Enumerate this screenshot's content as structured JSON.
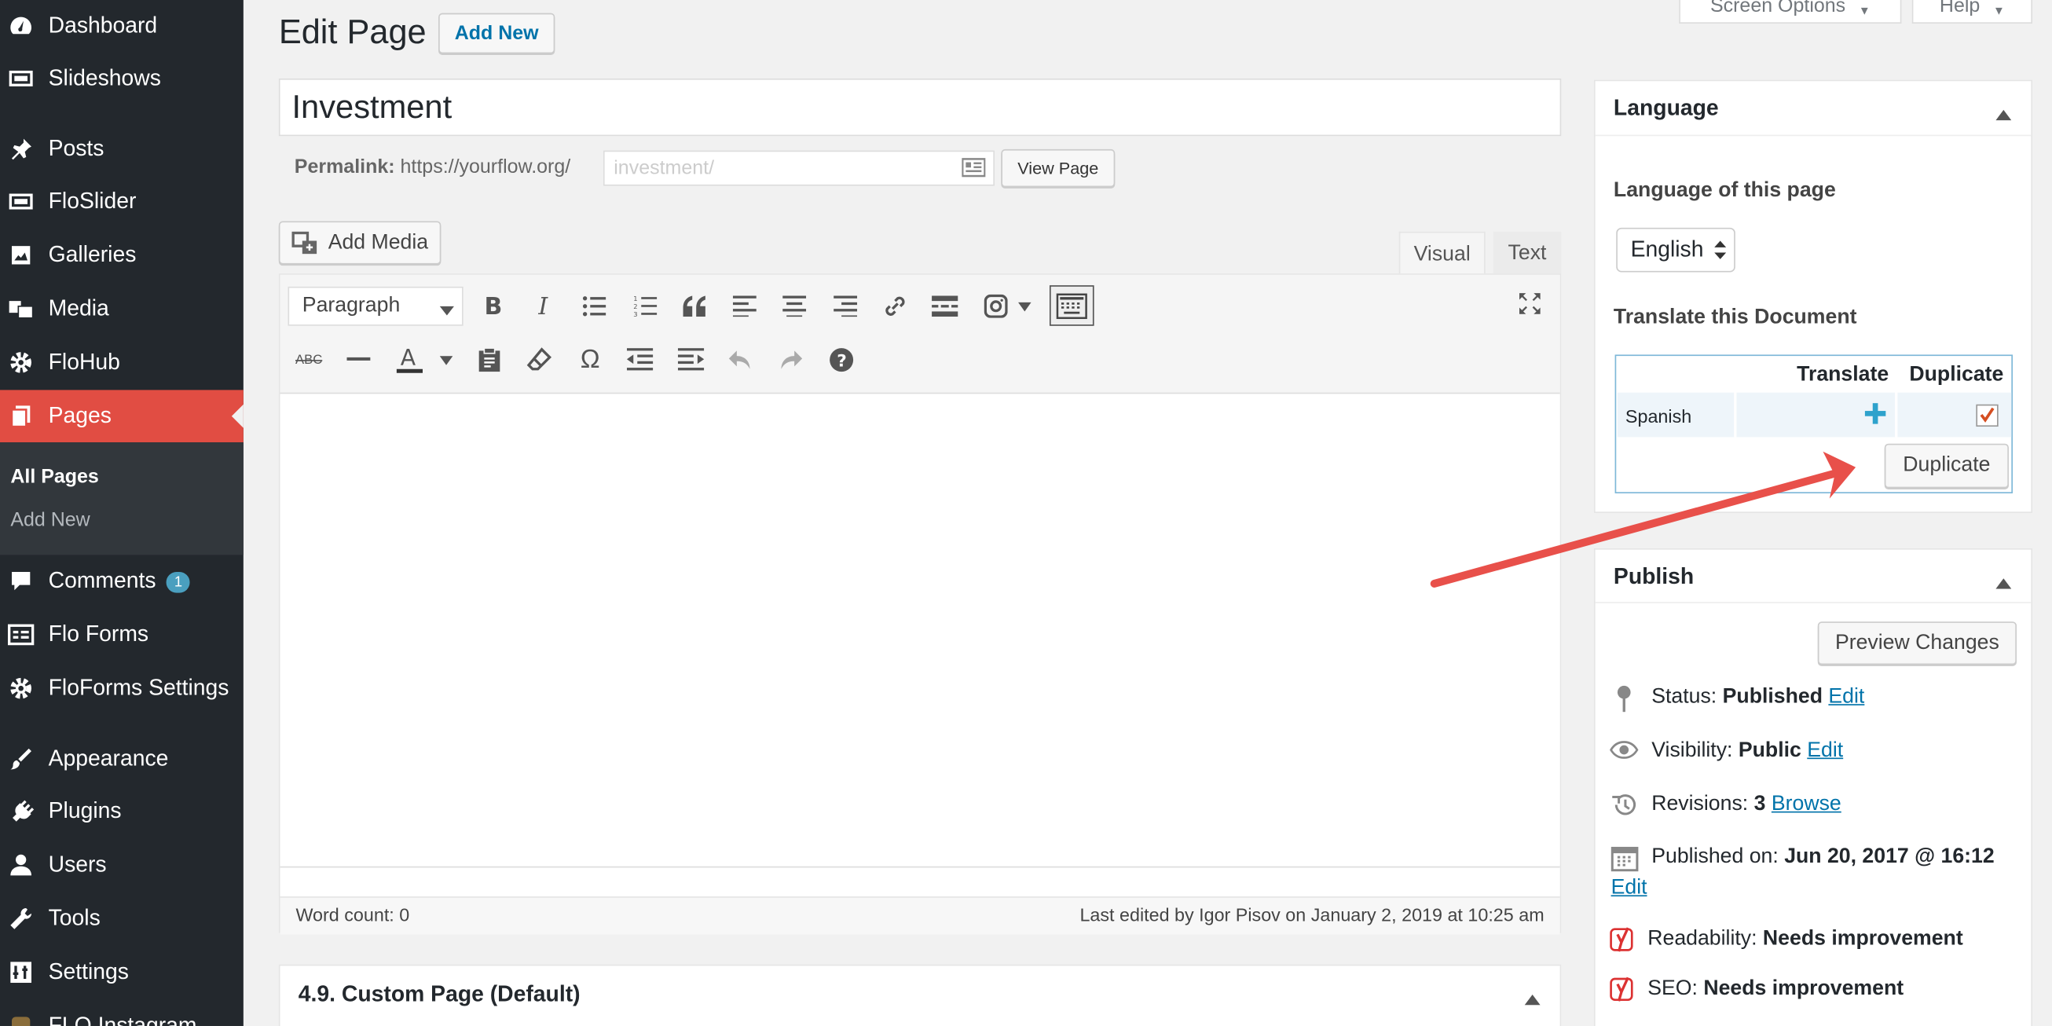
{
  "sidebar": {
    "items": [
      {
        "label": "Dashboard",
        "icon": "dashboard-icon"
      },
      {
        "label": "Slideshows",
        "icon": "slideshow-icon"
      },
      {
        "label": "Posts",
        "icon": "pin-icon"
      },
      {
        "label": "FloSlider",
        "icon": "slider-icon"
      },
      {
        "label": "Galleries",
        "icon": "gallery-icon"
      },
      {
        "label": "Media",
        "icon": "media-icon"
      },
      {
        "label": "FloHub",
        "icon": "gear-icon"
      },
      {
        "label": "Pages",
        "icon": "pages-icon"
      },
      {
        "label": "Comments",
        "icon": "comment-icon",
        "badge": "1"
      },
      {
        "label": "Flo Forms",
        "icon": "forms-icon"
      },
      {
        "label": "FloForms Settings",
        "icon": "gear-icon"
      },
      {
        "label": "Appearance",
        "icon": "brush-icon"
      },
      {
        "label": "Plugins",
        "icon": "plugin-icon"
      },
      {
        "label": "Users",
        "icon": "user-icon"
      },
      {
        "label": "Tools",
        "icon": "wrench-icon"
      },
      {
        "label": "Settings",
        "icon": "settings-icon"
      },
      {
        "label": "FLO Instagram",
        "icon": "instagram-icon"
      }
    ],
    "submenu": [
      "All Pages",
      "Add New"
    ]
  },
  "header": {
    "title": "Edit Page",
    "add_new": "Add New",
    "screen_options": "Screen Options",
    "help": "Help"
  },
  "editor": {
    "post_title": "Investment",
    "permalink_label": "Permalink:",
    "permalink_base": "https://yourflow.org/",
    "permalink_slug": "investment/",
    "view_page": "View Page",
    "add_media": "Add Media",
    "tab_visual": "Visual",
    "tab_text": "Text",
    "format_select": "Paragraph",
    "word_count": "Word count: 0",
    "last_edited": "Last edited by Igor Pisov on January 2, 2019 at 10:25 am"
  },
  "template_box": {
    "title": "4.9. Custom Page (Default)"
  },
  "language_box": {
    "title": "Language",
    "language_label": "Language of this page",
    "language_value": "English",
    "translate_label": "Translate this Document",
    "col_translate": "Translate",
    "col_duplicate": "Duplicate",
    "row_language": "Spanish",
    "duplicate_button": "Duplicate"
  },
  "publish_box": {
    "title": "Publish",
    "preview_button": "Preview Changes",
    "status_label": "Status:",
    "status_value": "Published",
    "visibility_label": "Visibility:",
    "visibility_value": "Public",
    "revisions_label": "Revisions:",
    "revisions_value": "3",
    "published_label": "Published on:",
    "published_value": "Jun 20, 2017 @ 16:12",
    "readability_label": "Readability:",
    "readability_value": "Needs improvement",
    "seo_label": "SEO:",
    "seo_value": "Needs improvement",
    "edit_link": "Edit",
    "browse_link": "Browse"
  },
  "colors": {
    "accent": "#e14d43",
    "link": "#0073aa",
    "sidebar": "#23282d",
    "annotation": "#e8504a"
  }
}
